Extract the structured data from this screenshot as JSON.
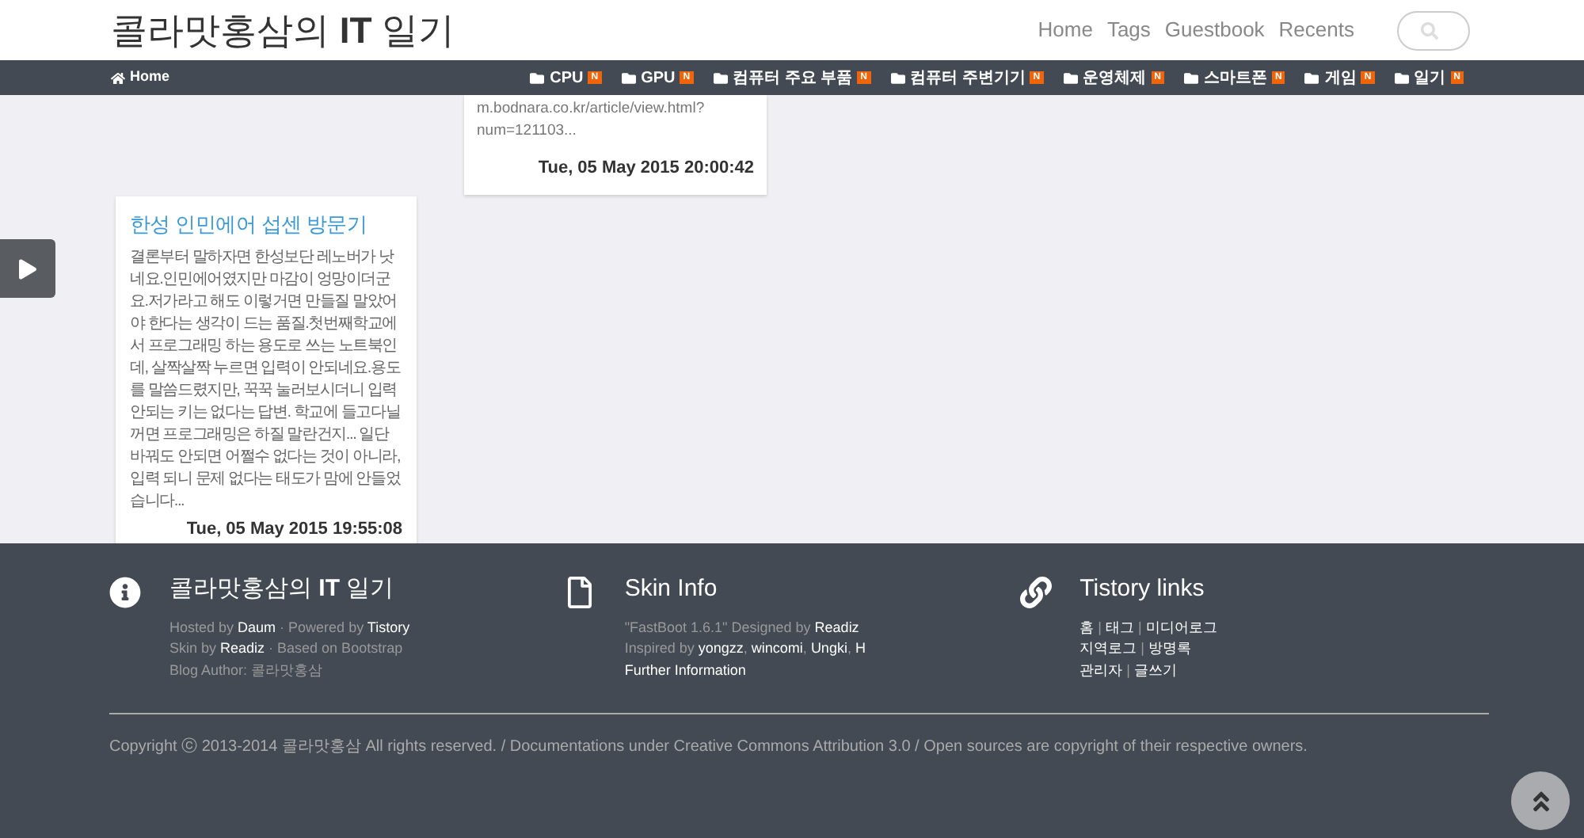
{
  "header": {
    "title": "콜라맛홍삼의 **IT** 일기",
    "links": [
      "Home",
      "Tags",
      "Guestbook",
      "Recents"
    ]
  },
  "nav": {
    "home": "Home",
    "items": [
      {
        "label": "CPU",
        "badge": "N"
      },
      {
        "label": "GPU",
        "badge": "N"
      },
      {
        "label": "컴퓨터 주요 부품",
        "badge": "N"
      },
      {
        "label": "컴퓨터 주변기기",
        "badge": "N"
      },
      {
        "label": "운영체제",
        "badge": "N"
      },
      {
        "label": "스마트폰",
        "badge": "N"
      },
      {
        "label": "게임",
        "badge": "N"
      },
      {
        "label": "일기",
        "badge": "N"
      }
    ]
  },
  "posts": [
    {
      "excerpt": "m.bodnara.co.kr/article/view.html?num=121103...",
      "date": "Tue, 05 May 2015 20:00:42"
    },
    {
      "title": "한성 인민에어 섭센 방문기",
      "excerpt": "결론부터 말하자면 한성보단 레노버가 낫네요.인민에어였지만 마감이 엉망이더군요.저가라고 해도 이렇거면 만들질 말았어야 한다는 생각이 드는 품질.첫번째학교에서 프로그래밍 하는 용도로 쓰는 노트북인데, 살짝살짝 누르면 입력이 안되네요.용도를 말씀드렸지만, 꾹꾹 눌러보시더니 입력안되는 키는 없다는 답변. 학교에 들고다닐꺼면 프로그래밍은 하질 말란건지... 일단 바꿔도 안되면 어쩔수 없다는 것이 아니라, 입력 되니 문제 없다는 태도가 맘에 안들었습니다...",
      "date": "Tue, 05 May 2015 19:55:08"
    }
  ],
  "footer": {
    "columns": [
      {
        "kind": "info",
        "title": "콜라맛홍삼의 **IT** 일기",
        "lines": [
          [
            {
              "text": "Hosted by ",
              "link": false
            },
            {
              "text": "Daum",
              "link": true
            },
            {
              "text": " · Powered by ",
              "link": false
            },
            {
              "text": "Tistory",
              "link": true
            }
          ],
          [
            {
              "text": "Skin by ",
              "link": false
            },
            {
              "text": "Readiz",
              "link": true
            },
            {
              "text": " · Based on Bootstrap",
              "link": false
            }
          ],
          [
            {
              "text": "Blog Author: 콜라맛홍삼",
              "link": false
            }
          ]
        ]
      },
      {
        "kind": "file",
        "title": "Skin Info",
        "lines": [
          [
            {
              "text": "\"FastBoot 1.6.1\" Designed by ",
              "link": false
            },
            {
              "text": "Readiz",
              "link": true
            }
          ],
          [
            {
              "text": "Inspired by ",
              "link": false
            },
            {
              "text": "yongzz",
              "link": true
            },
            {
              "text": ", ",
              "link": false
            },
            {
              "text": "wincomi",
              "link": true
            },
            {
              "text": ", ",
              "link": false
            },
            {
              "text": "Ungki",
              "link": true
            },
            {
              "text": ", ",
              "link": false
            },
            {
              "text": "H",
              "link": true
            }
          ],
          [
            {
              "text": "Further Information",
              "link": true
            }
          ]
        ]
      },
      {
        "kind": "link",
        "title": "Tistory links",
        "lines": [
          [
            {
              "text": "홈",
              "link": true
            },
            {
              "text": " | ",
              "link": false
            },
            {
              "text": "태그",
              "link": true
            },
            {
              "text": " | ",
              "link": false
            },
            {
              "text": "미디어로그",
              "link": true
            }
          ],
          [
            {
              "text": "지역로그",
              "link": true
            },
            {
              "text": " | ",
              "link": false
            },
            {
              "text": "방명록",
              "link": true
            }
          ],
          [
            {
              "text": "관리자",
              "link": true
            },
            {
              "text": " | ",
              "link": false
            },
            {
              "text": "글쓰기",
              "link": true
            }
          ]
        ]
      }
    ],
    "copyright": "Copyright ⓒ 2013-2014 콜라맛홍삼 All rights reserved. / Documentations under Creative Commons Attribution 3.0 / Open sources are copyright of their respective owners."
  }
}
